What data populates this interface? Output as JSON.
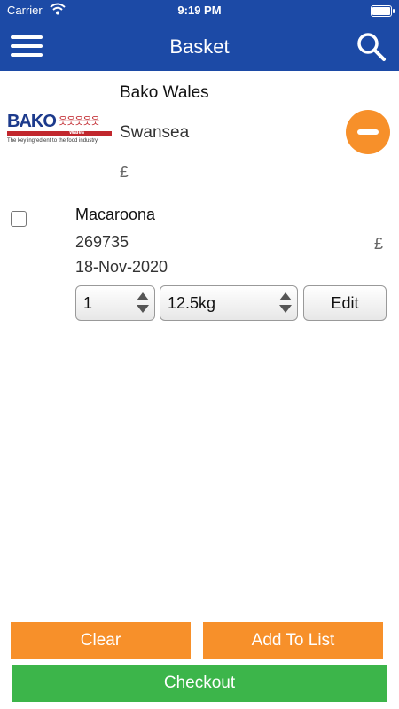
{
  "status_bar": {
    "carrier": "Carrier",
    "time": "9:19 PM"
  },
  "header": {
    "title": "Basket",
    "menu_icon": "hamburger-menu-icon",
    "search_icon": "search-icon"
  },
  "store": {
    "logo_text": "BAKO",
    "logo_sub": "Wales",
    "logo_tagline": "The key ingredient to the food industry",
    "name": "Bako Wales",
    "location": "Swansea",
    "currency": "£",
    "remove_icon": "minus-circle-icon",
    "remove_color": "#f7902a"
  },
  "items": [
    {
      "name": "Macaroona",
      "code": "269735",
      "date": "18-Nov-2020",
      "currency": "£",
      "quantity": "1",
      "unit": "12.5kg",
      "edit_label": "Edit"
    }
  ],
  "footer": {
    "clear_label": "Clear",
    "add_to_list_label": "Add To List",
    "checkout_label": "Checkout"
  },
  "colors": {
    "header": "#1c4aa6",
    "orange": "#f7902a",
    "green": "#3cb54a"
  }
}
